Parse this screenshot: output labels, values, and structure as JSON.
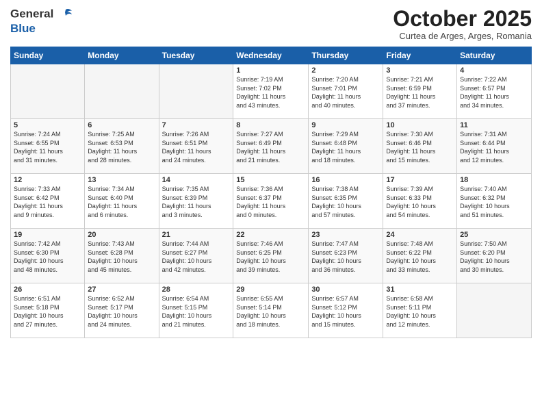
{
  "header": {
    "logo_line1": "General",
    "logo_line2": "Blue",
    "month": "October 2025",
    "location": "Curtea de Arges, Arges, Romania"
  },
  "weekdays": [
    "Sunday",
    "Monday",
    "Tuesday",
    "Wednesday",
    "Thursday",
    "Friday",
    "Saturday"
  ],
  "weeks": [
    [
      {
        "day": "",
        "info": ""
      },
      {
        "day": "",
        "info": ""
      },
      {
        "day": "",
        "info": ""
      },
      {
        "day": "1",
        "info": "Sunrise: 7:19 AM\nSunset: 7:02 PM\nDaylight: 11 hours\nand 43 minutes."
      },
      {
        "day": "2",
        "info": "Sunrise: 7:20 AM\nSunset: 7:01 PM\nDaylight: 11 hours\nand 40 minutes."
      },
      {
        "day": "3",
        "info": "Sunrise: 7:21 AM\nSunset: 6:59 PM\nDaylight: 11 hours\nand 37 minutes."
      },
      {
        "day": "4",
        "info": "Sunrise: 7:22 AM\nSunset: 6:57 PM\nDaylight: 11 hours\nand 34 minutes."
      }
    ],
    [
      {
        "day": "5",
        "info": "Sunrise: 7:24 AM\nSunset: 6:55 PM\nDaylight: 11 hours\nand 31 minutes."
      },
      {
        "day": "6",
        "info": "Sunrise: 7:25 AM\nSunset: 6:53 PM\nDaylight: 11 hours\nand 28 minutes."
      },
      {
        "day": "7",
        "info": "Sunrise: 7:26 AM\nSunset: 6:51 PM\nDaylight: 11 hours\nand 24 minutes."
      },
      {
        "day": "8",
        "info": "Sunrise: 7:27 AM\nSunset: 6:49 PM\nDaylight: 11 hours\nand 21 minutes."
      },
      {
        "day": "9",
        "info": "Sunrise: 7:29 AM\nSunset: 6:48 PM\nDaylight: 11 hours\nand 18 minutes."
      },
      {
        "day": "10",
        "info": "Sunrise: 7:30 AM\nSunset: 6:46 PM\nDaylight: 11 hours\nand 15 minutes."
      },
      {
        "day": "11",
        "info": "Sunrise: 7:31 AM\nSunset: 6:44 PM\nDaylight: 11 hours\nand 12 minutes."
      }
    ],
    [
      {
        "day": "12",
        "info": "Sunrise: 7:33 AM\nSunset: 6:42 PM\nDaylight: 11 hours\nand 9 minutes."
      },
      {
        "day": "13",
        "info": "Sunrise: 7:34 AM\nSunset: 6:40 PM\nDaylight: 11 hours\nand 6 minutes."
      },
      {
        "day": "14",
        "info": "Sunrise: 7:35 AM\nSunset: 6:39 PM\nDaylight: 11 hours\nand 3 minutes."
      },
      {
        "day": "15",
        "info": "Sunrise: 7:36 AM\nSunset: 6:37 PM\nDaylight: 11 hours\nand 0 minutes."
      },
      {
        "day": "16",
        "info": "Sunrise: 7:38 AM\nSunset: 6:35 PM\nDaylight: 10 hours\nand 57 minutes."
      },
      {
        "day": "17",
        "info": "Sunrise: 7:39 AM\nSunset: 6:33 PM\nDaylight: 10 hours\nand 54 minutes."
      },
      {
        "day": "18",
        "info": "Sunrise: 7:40 AM\nSunset: 6:32 PM\nDaylight: 10 hours\nand 51 minutes."
      }
    ],
    [
      {
        "day": "19",
        "info": "Sunrise: 7:42 AM\nSunset: 6:30 PM\nDaylight: 10 hours\nand 48 minutes."
      },
      {
        "day": "20",
        "info": "Sunrise: 7:43 AM\nSunset: 6:28 PM\nDaylight: 10 hours\nand 45 minutes."
      },
      {
        "day": "21",
        "info": "Sunrise: 7:44 AM\nSunset: 6:27 PM\nDaylight: 10 hours\nand 42 minutes."
      },
      {
        "day": "22",
        "info": "Sunrise: 7:46 AM\nSunset: 6:25 PM\nDaylight: 10 hours\nand 39 minutes."
      },
      {
        "day": "23",
        "info": "Sunrise: 7:47 AM\nSunset: 6:23 PM\nDaylight: 10 hours\nand 36 minutes."
      },
      {
        "day": "24",
        "info": "Sunrise: 7:48 AM\nSunset: 6:22 PM\nDaylight: 10 hours\nand 33 minutes."
      },
      {
        "day": "25",
        "info": "Sunrise: 7:50 AM\nSunset: 6:20 PM\nDaylight: 10 hours\nand 30 minutes."
      }
    ],
    [
      {
        "day": "26",
        "info": "Sunrise: 6:51 AM\nSunset: 5:18 PM\nDaylight: 10 hours\nand 27 minutes."
      },
      {
        "day": "27",
        "info": "Sunrise: 6:52 AM\nSunset: 5:17 PM\nDaylight: 10 hours\nand 24 minutes."
      },
      {
        "day": "28",
        "info": "Sunrise: 6:54 AM\nSunset: 5:15 PM\nDaylight: 10 hours\nand 21 minutes."
      },
      {
        "day": "29",
        "info": "Sunrise: 6:55 AM\nSunset: 5:14 PM\nDaylight: 10 hours\nand 18 minutes."
      },
      {
        "day": "30",
        "info": "Sunrise: 6:57 AM\nSunset: 5:12 PM\nDaylight: 10 hours\nand 15 minutes."
      },
      {
        "day": "31",
        "info": "Sunrise: 6:58 AM\nSunset: 5:11 PM\nDaylight: 10 hours\nand 12 minutes."
      },
      {
        "day": "",
        "info": ""
      }
    ]
  ]
}
